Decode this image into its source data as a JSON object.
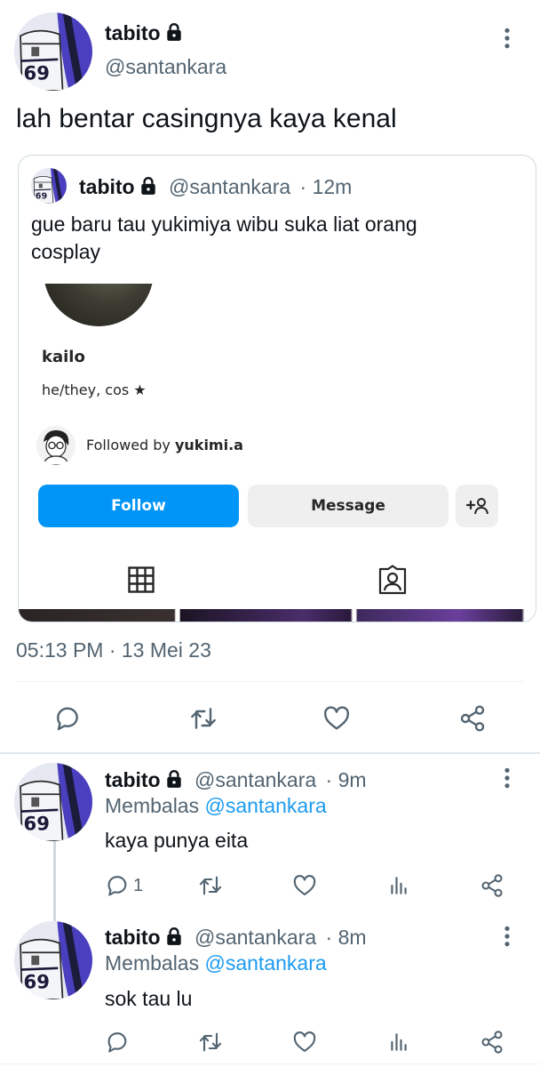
{
  "main_tweet": {
    "name": "tabito",
    "handle": "@santankara",
    "text": "lah bentar casingnya kaya kenal",
    "timestamp": "05:13 PM · 13 Mei 23"
  },
  "quoted_tweet": {
    "name": "tabito",
    "handle": "@santankara",
    "time": "· 12m",
    "text_line1": "gue baru tau yukimiya wibu suka liat orang",
    "text_line2": "cosplay",
    "profile": {
      "username": "kailo",
      "bio": "he/they, cos ★",
      "followed_by_prefix": "Followed by ",
      "followed_by_user": "yukimi.a",
      "follow_button": "Follow",
      "message_button": "Message"
    }
  },
  "replies": [
    {
      "name": "tabito",
      "handle": "@santankara",
      "time": "· 9m",
      "replying_prefix": "Membalas",
      "replying_to": "@santankara",
      "text": "kaya punya eita",
      "reply_count": "1"
    },
    {
      "name": "tabito",
      "handle": "@santankara",
      "time": "· 8m",
      "replying_prefix": "Membalas",
      "replying_to": "@santankara",
      "text": "sok tau lu",
      "reply_count": ""
    }
  ],
  "colors": {
    "link": "#1d9bf0",
    "secondary_text": "#536471",
    "ig_follow_blue": "#0095f6",
    "ig_button_gray": "#efefef",
    "avatar_purple": "#4a3fbf"
  },
  "icons": [
    "lock-icon",
    "more-icon",
    "reply-icon",
    "retweet-icon",
    "like-icon",
    "share-icon",
    "views-icon",
    "grid-icon",
    "tagged-icon",
    "add-person-icon"
  ]
}
